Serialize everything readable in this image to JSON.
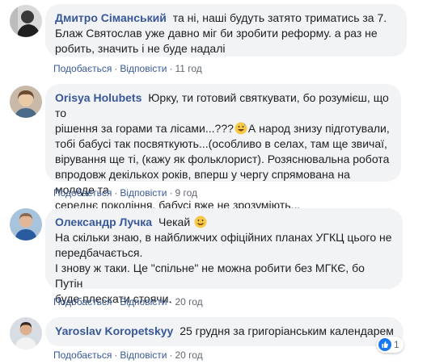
{
  "comments": [
    {
      "author": "Дмитро Сіманський",
      "lines": [
        "та ні, наші будуть затято триматись за 7.",
        "Блаж Святослав уже давно міг би зробити реформу. а раз не",
        "робить, значить і не буде надалі"
      ],
      "like_label": "Подобається",
      "reply_label": "Відповісти",
      "time": "11 год"
    },
    {
      "author": "Orisya Holubets",
      "lines": [
        "Юрку, ти готовий святкувати, бо розумієш, що то",
        "рішення за горами та лісами...???",
        "А народ знизу підготували,",
        "тобі бабусі так посвяткують...(особливо в селах, там ще звичаї,",
        "вірування ще ті, (кажу як фольклорист). Розяснювальна робота",
        "впродовж декількох років, вперш у чергу спрямована на молоде та",
        "середнє покоління, бабусі вже не зрозуміють..."
      ],
      "like_label": "Подобається",
      "reply_label": "Відповісти",
      "time": "9 год"
    },
    {
      "author": "Олександр Лучка",
      "first_text": "Чекай",
      "lines": [
        "На скільки знаю, в найближчих офіційних планах УГКЦ цього не",
        "передбачається.",
        "І знову ж таки. Це \"спільне\" не можна робити без МГКЄ, бо Путін",
        "буде плескати стоячи."
      ],
      "like_label": "Подобається",
      "reply_label": "Відповісти",
      "time": "20 год"
    },
    {
      "author": "Yaroslav Koropetskyy",
      "lines": [
        "25 грудня за григоріанським календарем"
      ],
      "like_label": "Подобається",
      "reply_label": "Відповісти",
      "time": "20 год",
      "reaction_count": "1"
    }
  ],
  "separator": "·",
  "icons": {
    "laugh": "grinning-sweat-emoji-icon",
    "smile": "smiling-emoji-icon",
    "like": "like-thumb-icon"
  },
  "colors": {
    "author": "#385898",
    "bubble": "#f2f3f5",
    "meta": "#606770",
    "like_blue": "#1877f2"
  }
}
